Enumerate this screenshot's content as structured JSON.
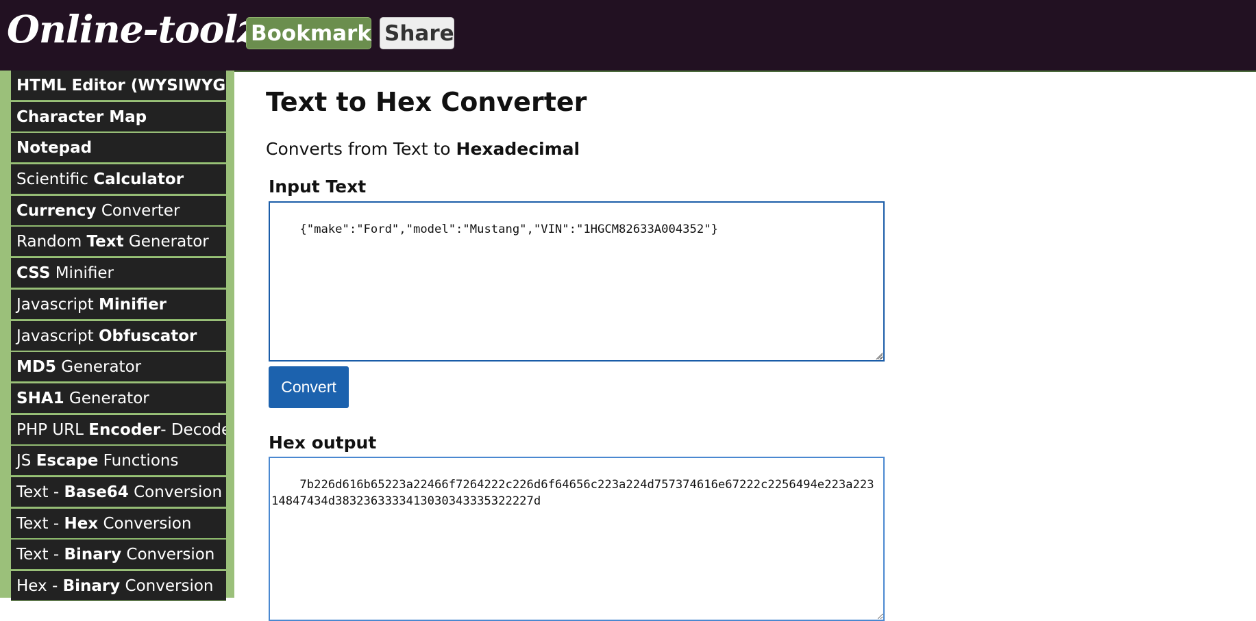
{
  "header": {
    "logo": "Online-toolz",
    "bookmark_label": "Bookmark",
    "share_label": "Share"
  },
  "sidebar": {
    "items": [
      {
        "pre": "",
        "bold": "HTML Editor (WYSIWYG)",
        "post": ""
      },
      {
        "pre": "",
        "bold": "Character Map",
        "post": ""
      },
      {
        "pre": "",
        "bold": "Notepad",
        "post": ""
      },
      {
        "pre": "Scientific ",
        "bold": "Calculator",
        "post": ""
      },
      {
        "pre": "",
        "bold": "Currency",
        "post": " Converter"
      },
      {
        "pre": "Random ",
        "bold": "Text",
        "post": " Generator"
      },
      {
        "pre": "",
        "bold": "CSS",
        "post": " Minifier"
      },
      {
        "pre": "Javascript ",
        "bold": "Minifier",
        "post": ""
      },
      {
        "pre": "Javascript ",
        "bold": "Obfuscator",
        "post": ""
      },
      {
        "pre": "",
        "bold": "MD5",
        "post": " Generator"
      },
      {
        "pre": "",
        "bold": "SHA1",
        "post": " Generator"
      },
      {
        "pre": "PHP URL ",
        "bold": "Encoder",
        "post": "- Decoder"
      },
      {
        "pre": "JS ",
        "bold": "Escape",
        "post": " Functions"
      },
      {
        "pre": "Text - ",
        "bold": "Base64",
        "post": " Conversion"
      },
      {
        "pre": "Text - ",
        "bold": "Hex",
        "post": " Conversion"
      },
      {
        "pre": "Text - ",
        "bold": "Binary",
        "post": " Conversion"
      },
      {
        "pre": "Hex - ",
        "bold": "Binary",
        "post": " Conversion"
      }
    ]
  },
  "main": {
    "title": "Text to Hex Converter",
    "subtitle_pre": "Converts from Text to ",
    "subtitle_bold": "Hexadecimal",
    "input_label": "Input Text",
    "input_value": "{\"make\":\"Ford\",\"model\":\"Mustang\",\"VIN\":\"1HGCM82633A004352\"}",
    "convert_label": "Convert",
    "output_label": "Hex output",
    "output_value": "7b226d616b65223a22466f7264222c226d6f64656c223a224d757374616e67222c2256494e223a223\n14847434d3832363333413030343335322227d"
  },
  "colors": {
    "topbar": "#221122",
    "sidebar_bg": "#9bc07a",
    "sidebar_item": "#222222",
    "accent_blue": "#1c62ae",
    "bookmark_green": "#6b8e4e"
  }
}
